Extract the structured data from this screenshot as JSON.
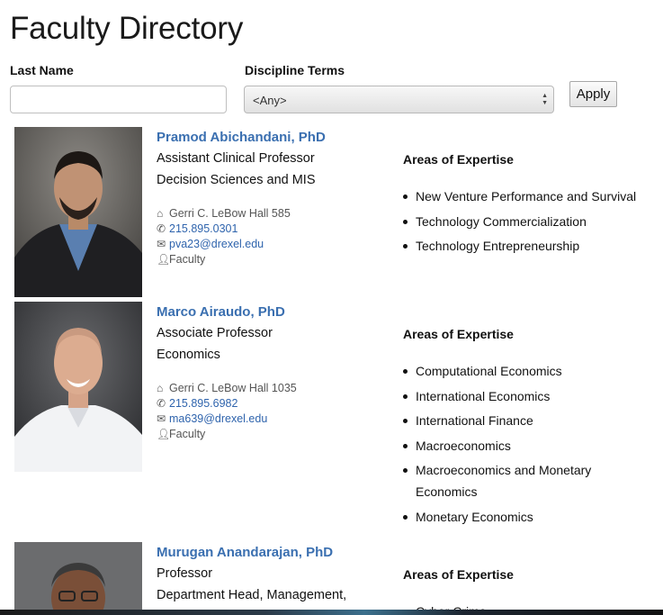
{
  "page": {
    "title": "Faculty Directory"
  },
  "filters": {
    "last_name_label": "Last Name",
    "last_name_value": "",
    "discipline_label": "Discipline Terms",
    "discipline_selected": "<Any>",
    "apply_label": "Apply"
  },
  "faculty": [
    {
      "name": "Pramod Abichandani, PhD",
      "title": "Assistant Clinical Professor",
      "department": "Decision Sciences and MIS",
      "office": "Gerri C. LeBow Hall 585",
      "phone": "215.895.0301",
      "email": "pva23@drexel.edu",
      "role": "Faculty",
      "aoe_heading": "Areas of Expertise",
      "expertise": [
        "New Venture Performance and Survival",
        "Technology Commercialization",
        "Technology Entrepreneurship"
      ]
    },
    {
      "name": "Marco Airaudo, PhD",
      "title": "Associate Professor",
      "department": "Economics",
      "office": "Gerri C. LeBow Hall 1035",
      "phone": "215.895.6982",
      "email": "ma639@drexel.edu",
      "role": "Faculty",
      "aoe_heading": "Areas of Expertise",
      "expertise": [
        "Computational Economics",
        "International Economics",
        "International Finance",
        "Macroeconomics",
        "Macroeconomics and Monetary Economics",
        "Monetary Economics"
      ]
    },
    {
      "name": "Murugan Anandarajan, PhD",
      "title": "Professor",
      "department": "Department Head, Management,",
      "aoe_heading": "Areas of Expertise",
      "expertise": [
        "Cyber Crime"
      ]
    }
  ],
  "icons": {
    "office": "home-icon",
    "phone": "phone-icon",
    "email": "envelope-icon",
    "role": "user-icon"
  },
  "colors": {
    "link": "#3a6fb0",
    "text": "#111111"
  }
}
